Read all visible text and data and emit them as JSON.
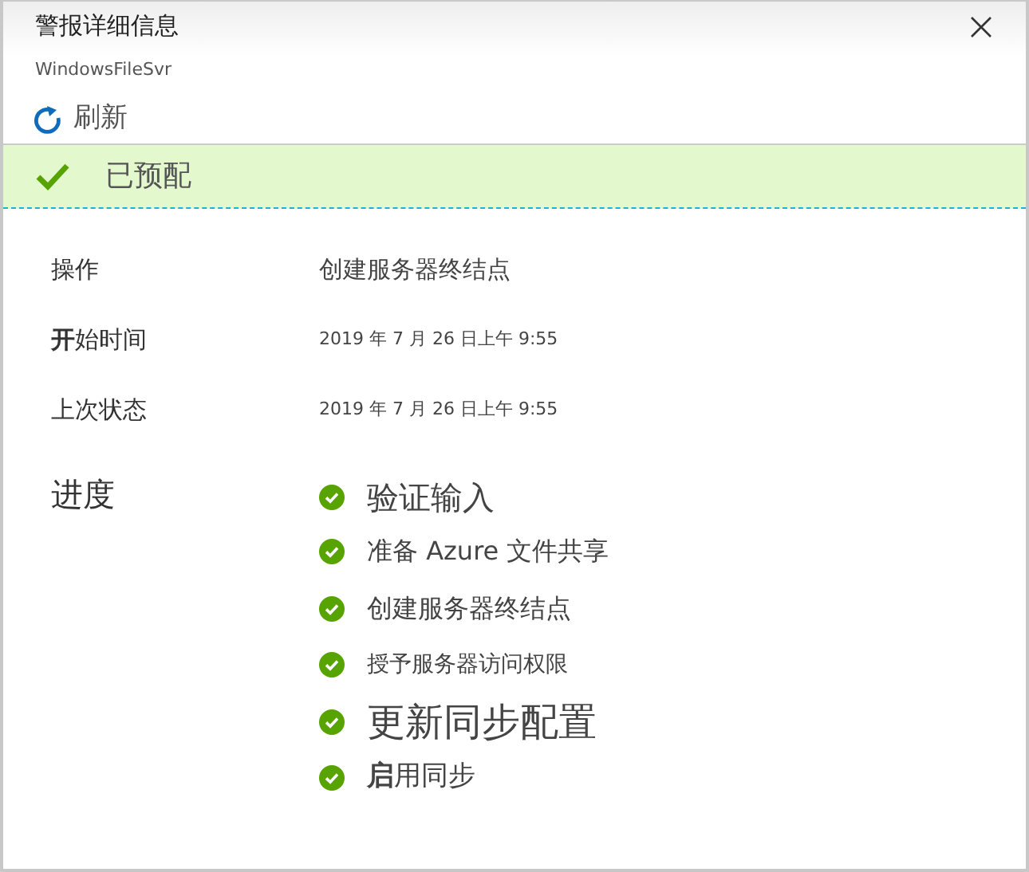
{
  "window": {
    "title": "警报详细信息",
    "subtitle": "WindowsFileSvr"
  },
  "toolbar": {
    "refresh": "刷新"
  },
  "status_banner": {
    "text": "已预配",
    "success": true
  },
  "details": [
    {
      "label": "操作",
      "value": "创建服务器终结点"
    },
    {
      "label": "**开**始时间",
      "value": "2019 年 7 月 26 日上午 9:55"
    },
    {
      "label": "上次状态",
      "value": "2019 年 7 月 26 日上午 9:55"
    }
  ],
  "progress": {
    "label": "进度",
    "steps": [
      {
        "text": "验证输入",
        "completed": true
      },
      {
        "text": "准备 Azure 文件共享",
        "completed": true
      },
      {
        "text": "创建服务器终结点",
        "completed": true
      },
      {
        "text": "授予服务器访问权限",
        "completed": true
      },
      {
        "text": "更新同步配置",
        "completed": true
      },
      {
        "text": "**启**用同步",
        "completed": true
      }
    ]
  }
}
